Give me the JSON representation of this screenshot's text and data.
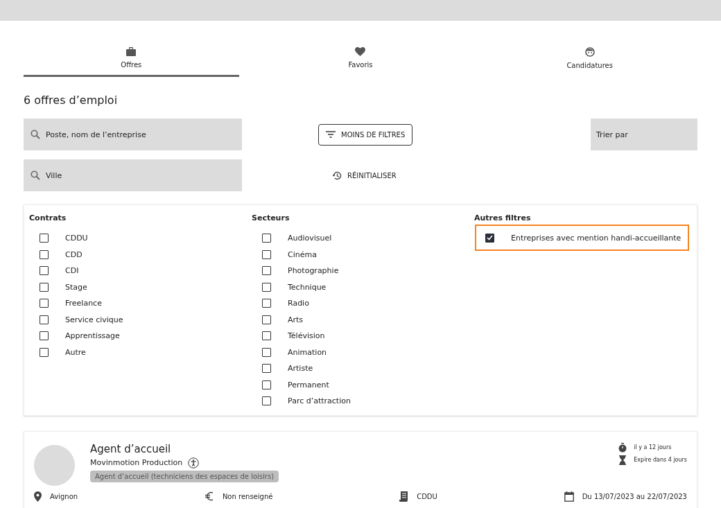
{
  "tabs": [
    {
      "label": "Offres",
      "kind": "briefcase",
      "selected": true
    },
    {
      "label": "Favoris",
      "kind": "heart",
      "selected": false
    },
    {
      "label": "Candidatures",
      "kind": "face",
      "selected": false
    }
  ],
  "results_title": "6 offres d’emploi",
  "search": {
    "placeholder": "Poste, nom de l’entreprise"
  },
  "city": {
    "placeholder": "Ville"
  },
  "filters_button": "MOINS DE FILTRES",
  "reset_button": "RÉINITIALISER",
  "sort": {
    "placeholder": "Trier par"
  },
  "filter_groups": [
    {
      "title": "Contrats",
      "options": [
        {
          "label": "CDDU",
          "checked": false,
          "focused": false
        },
        {
          "label": "CDD",
          "checked": false,
          "focused": false
        },
        {
          "label": "CDI",
          "checked": false,
          "focused": false
        },
        {
          "label": "Stage",
          "checked": false,
          "focused": false
        },
        {
          "label": "Freelance",
          "checked": false,
          "focused": false
        },
        {
          "label": "Service civique",
          "checked": false,
          "focused": false
        },
        {
          "label": "Apprentissage",
          "checked": false,
          "focused": false
        },
        {
          "label": "Autre",
          "checked": false,
          "focused": false
        }
      ]
    },
    {
      "title": "Secteurs",
      "options": [
        {
          "label": "Audiovisuel",
          "checked": false,
          "focused": false
        },
        {
          "label": "Cinéma",
          "checked": false,
          "focused": false
        },
        {
          "label": "Photographie",
          "checked": false,
          "focused": false
        },
        {
          "label": "Technique",
          "checked": false,
          "focused": false
        },
        {
          "label": "Radio",
          "checked": false,
          "focused": false
        },
        {
          "label": "Arts",
          "checked": false,
          "focused": false
        },
        {
          "label": "Télévision",
          "checked": false,
          "focused": false
        },
        {
          "label": "Animation",
          "checked": false,
          "focused": false
        },
        {
          "label": "Artiste",
          "checked": false,
          "focused": false
        },
        {
          "label": "Permanent",
          "checked": false,
          "focused": false
        },
        {
          "label": "Parc d’attraction",
          "checked": false,
          "focused": false
        }
      ]
    },
    {
      "title": "Autres filtres",
      "options": [
        {
          "label": "Entreprises avec mention handi-accueillante",
          "checked": true,
          "focused": true
        }
      ]
    }
  ],
  "jobs": [
    {
      "title": "Agent d’accueil",
      "company": "Movinmotion Production",
      "accessible": true,
      "tag": "Agent d’accueil (techniciens des espaces de loisirs)",
      "posted": "il y a 12 jours",
      "expires": "Expire dans 4 jours",
      "location": "Avignon",
      "salary": "Non renseigné",
      "contract": "CDDU",
      "dates": "Du 13/07/2023 au 22/07/2023"
    }
  ]
}
